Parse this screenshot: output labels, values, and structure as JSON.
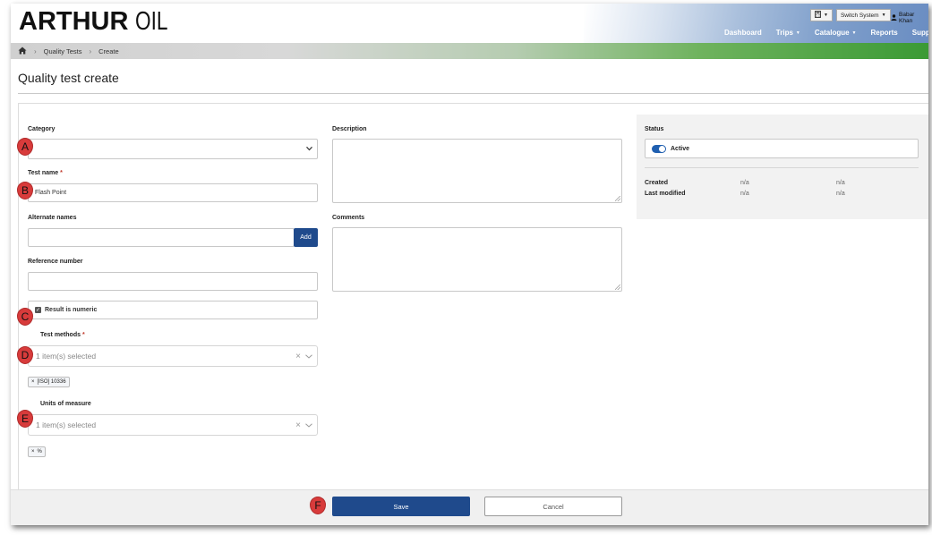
{
  "header": {
    "logo_bold": "ARTHUR",
    "logo_light": "OIL",
    "switch_system": "Switch System",
    "user": "Babar Khan",
    "nav": [
      {
        "label": "Dashboard",
        "caret": false
      },
      {
        "label": "Trips",
        "caret": true
      },
      {
        "label": "Catalogue",
        "caret": true
      },
      {
        "label": "Reports",
        "caret": false
      },
      {
        "label": "Support",
        "caret": false
      }
    ]
  },
  "breadcrumb": {
    "items": [
      "Quality Tests",
      "Create"
    ]
  },
  "page": {
    "title": "Quality test create"
  },
  "form": {
    "category_label": "Category",
    "category_value": "",
    "test_name_label": "Test name",
    "required_mark": "*",
    "test_name_value": "Flash Point",
    "alternate_names_label": "Alternate names",
    "alternate_names_value": "",
    "add_label": "Add",
    "reference_number_label": "Reference number",
    "reference_number_value": "",
    "result_numeric_label": "Result is numeric",
    "result_numeric_checked": true,
    "test_methods_label": "Test methods",
    "test_methods_summary": "1 item(s) selected",
    "test_methods_chips": [
      "[ISO] 10336"
    ],
    "units_label": "Units of measure",
    "units_summary": "1 item(s) selected",
    "units_chips": [
      "%"
    ],
    "description_label": "Description",
    "comments_label": "Comments"
  },
  "status": {
    "label": "Status",
    "active_label": "Active",
    "active": true,
    "created_label": "Created",
    "modified_label": "Last modified",
    "created_by": "n/a",
    "created_at": "n/a",
    "modified_by": "n/a",
    "modified_at": "n/a"
  },
  "footer": {
    "save_label": "Save",
    "cancel_label": "Cancel"
  },
  "markers": [
    "A",
    "B",
    "C",
    "D",
    "E",
    "F"
  ],
  "icons": {
    "remove": "×",
    "chevron": "⌄",
    "checked": "✓"
  },
  "colors": {
    "primary": "#1f4a8c",
    "marker": "#d83b3b",
    "nav_green": "#3b9a35"
  }
}
